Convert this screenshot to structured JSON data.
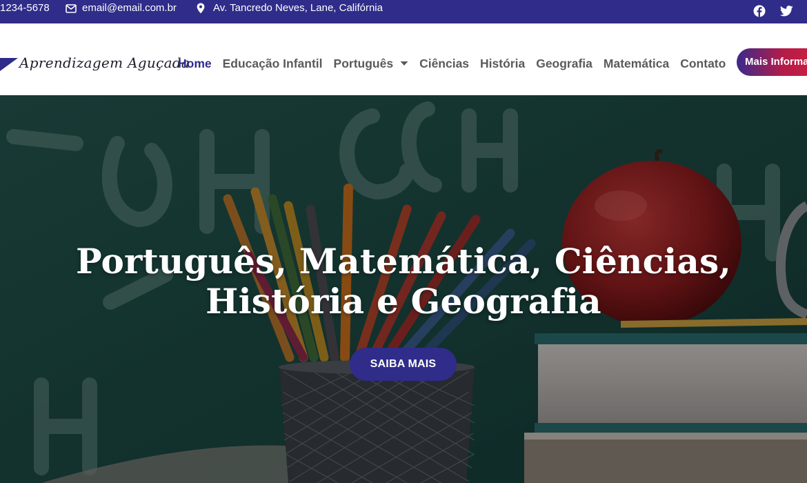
{
  "colors": {
    "brand": "#2f2c8a",
    "cta_gradient_start": "#3a2a8c",
    "cta_gradient_end": "#d01e3c",
    "nav_text": "#5a5a5a",
    "hero_overlay": "#1f4b45"
  },
  "topbar": {
    "phone": "1234-5678",
    "email_icon": "envelope-icon",
    "email": "email@email.com.br",
    "address_icon": "map-pin-icon",
    "address": "Av. Tancredo Neves, Lane, Califórnia",
    "social": [
      {
        "icon": "facebook-icon"
      },
      {
        "icon": "twitter-icon"
      }
    ]
  },
  "header": {
    "logo_text": "Aprendizagem Aguçada",
    "nav": [
      {
        "label": "Home",
        "active": true
      },
      {
        "label": "Educação Infantil"
      },
      {
        "label": "Português",
        "has_dropdown": true
      },
      {
        "label": "Ciências"
      },
      {
        "label": "História"
      },
      {
        "label": "Geografia"
      },
      {
        "label": "Matemática"
      },
      {
        "label": "Contato"
      }
    ],
    "cta_label": "Mais Informações"
  },
  "hero": {
    "title_line1": "Português, Matemática, Ciências,",
    "title_line2": "História e Geografia",
    "button_label": "SAIBA MAIS"
  }
}
